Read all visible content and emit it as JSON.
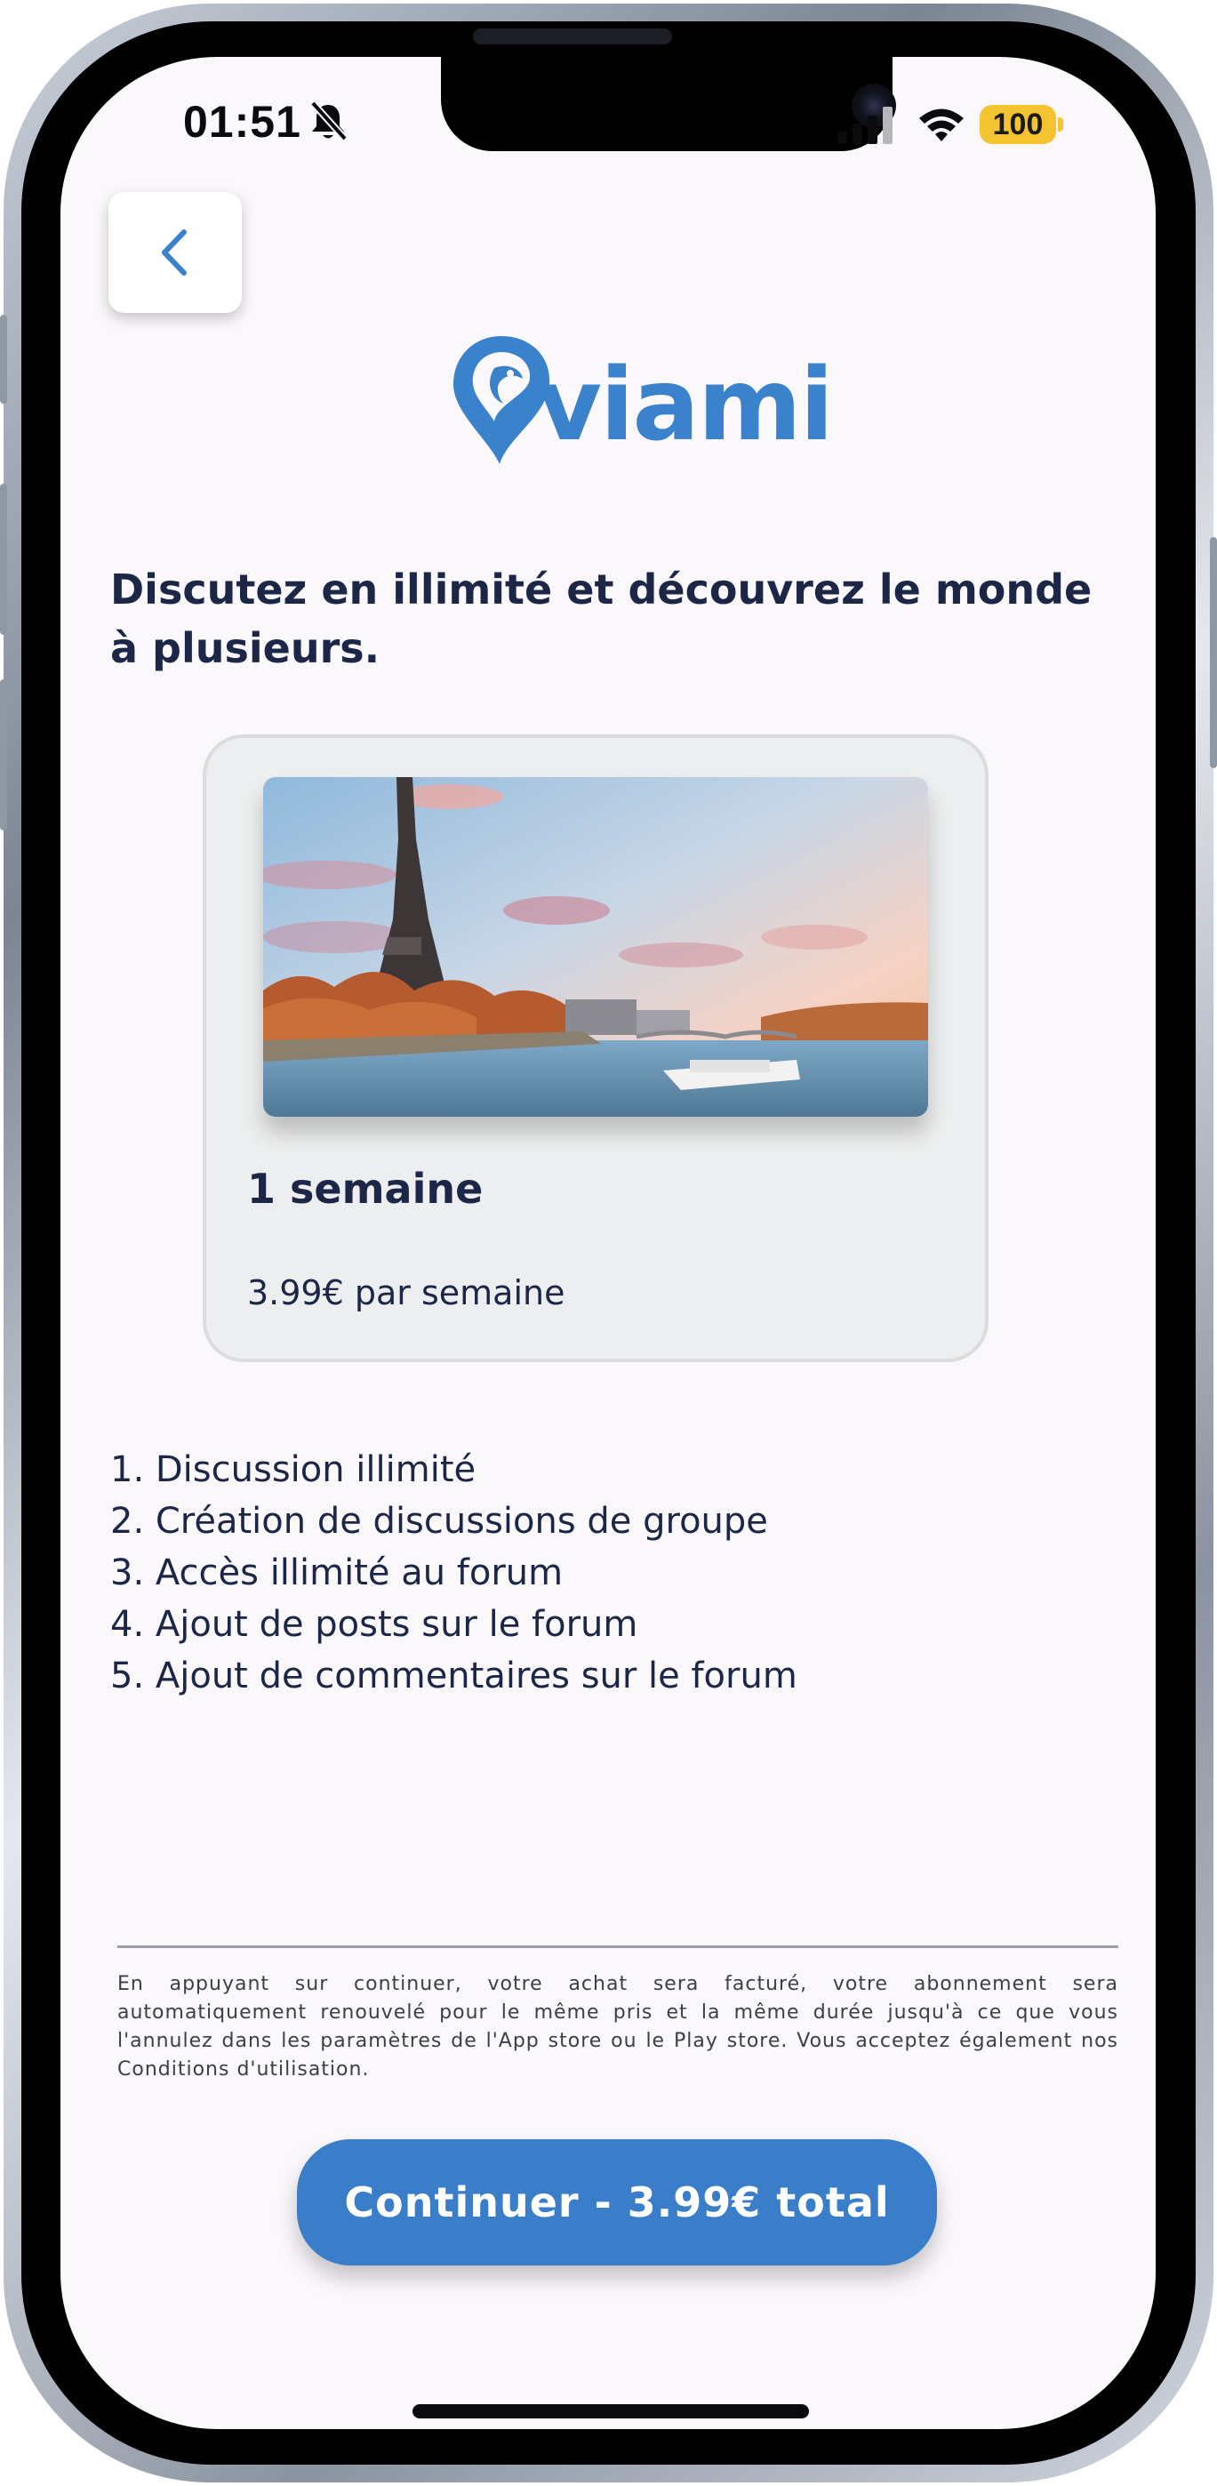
{
  "status_bar": {
    "time": "01:51",
    "battery": "100",
    "icons": [
      "bell-slash-icon",
      "cellular-signal-icon",
      "wifi-icon",
      "battery-icon"
    ],
    "battery_color": "#f4c430"
  },
  "header": {
    "back_icon": "chevron-left-icon",
    "logo_text": "viami",
    "brand_color": "#3a82cc"
  },
  "headline": "Discutez en illimité et découvrez le monde à plusieurs.",
  "plan": {
    "image": "eiffel-tower-seine-photo",
    "title": "1 semaine",
    "price": "3.99€ par semaine"
  },
  "features": [
    "1. Discussion illimité",
    "2. Création de discussions de groupe",
    "3. Accès illimité au forum",
    "4. Ajout de posts sur le forum",
    "5. Ajout de commentaires sur le forum"
  ],
  "legal_text": "En appuyant sur continuer, votre achat sera facturé, votre abonnement sera automatiquement renouvelé pour le même pris et la même durée jusqu'à ce que vous l'annulez dans les paramètres de l'App store ou le Play store. Vous acceptez également nos Conditions d'utilisation.",
  "cta": {
    "label": "Continuer - 3.99€ total",
    "color": "#3a7dc9"
  },
  "colors": {
    "text_dark": "#1c2748",
    "background": "#fbf8fb",
    "card_bg": "#eceeef"
  }
}
